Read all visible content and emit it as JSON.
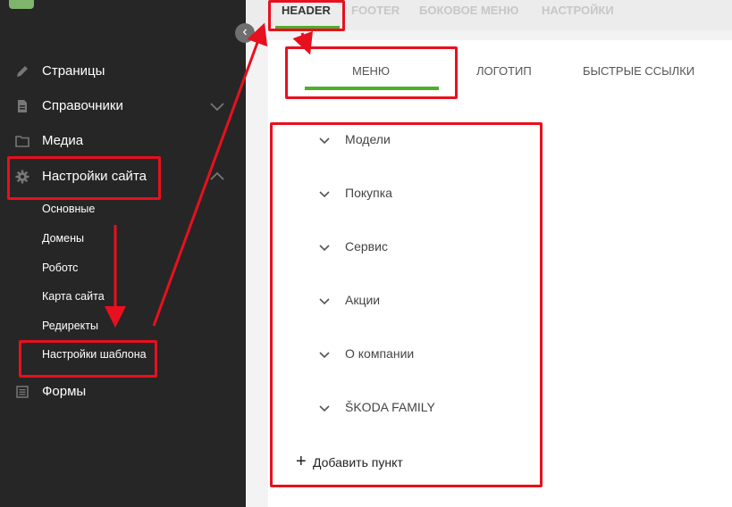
{
  "sidebar": {
    "logo_text": "",
    "collapse_symbol": "‹",
    "items": [
      {
        "label": "Страницы",
        "icon": "pencil-icon"
      },
      {
        "label": "Справочники",
        "icon": "document-icon",
        "expandable": true
      },
      {
        "label": "Медиа",
        "icon": "folder-icon"
      },
      {
        "label": "Настройки сайта",
        "icon": "gear-icon",
        "expanded": true
      },
      {
        "label": "Формы",
        "icon": "list-icon"
      }
    ],
    "subitems": [
      "Основные",
      "Домены",
      "Роботс",
      "Карта сайта",
      "Редиректы",
      "Настройки шаблона"
    ]
  },
  "top_tabs": [
    "HEADER",
    "FOOTER",
    "БОКОВОЕ МЕНЮ",
    "НАСТРОЙКИ"
  ],
  "sub_tabs": [
    "МЕНЮ",
    "ЛОГОТИП",
    "БЫСТРЫЕ ССЫЛКИ"
  ],
  "menu_items": [
    "Модели",
    "Покупка",
    "Сервис",
    "Акции",
    "О компании",
    "ŠKODA FAMILY"
  ],
  "add_item_label": "Добавить пункт",
  "colors": {
    "sidebar_bg": "#262626",
    "accent_green": "#4caf2f",
    "highlight_red": "#e8101e"
  }
}
